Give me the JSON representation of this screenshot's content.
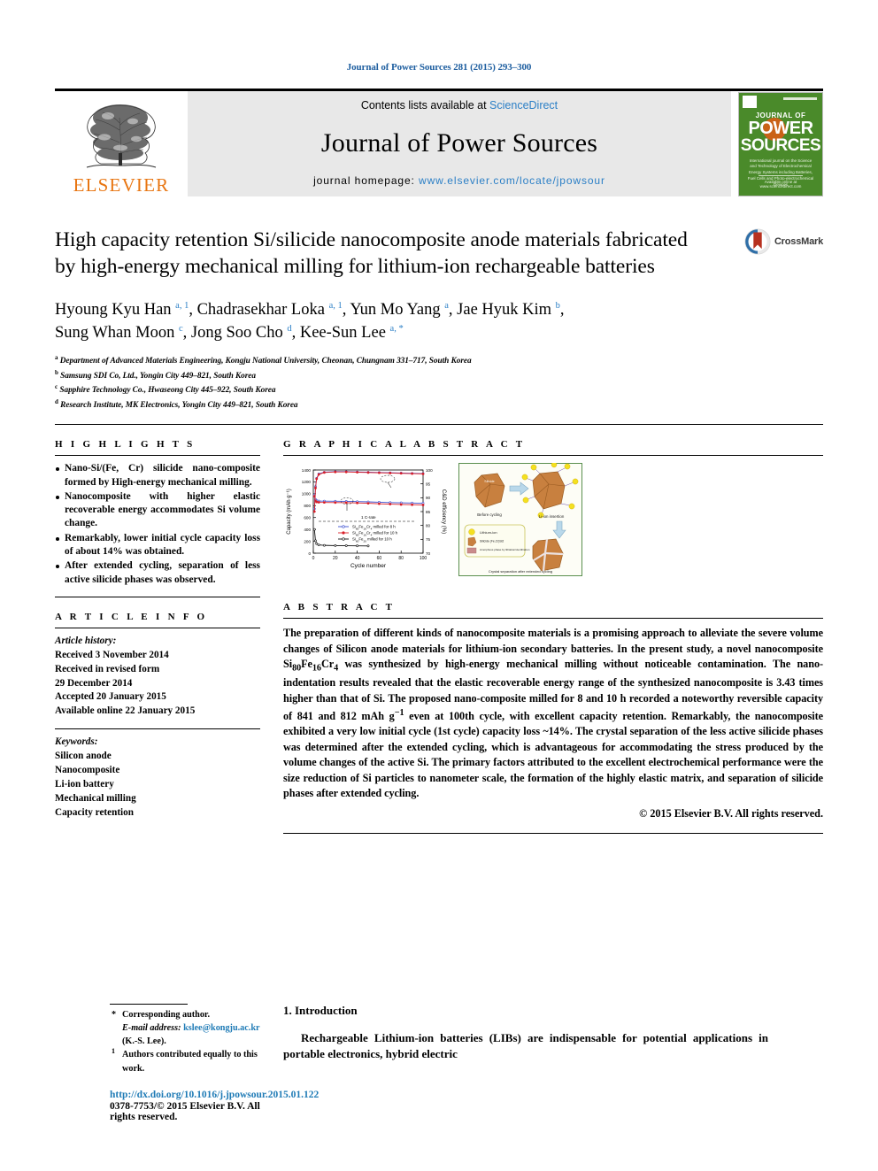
{
  "running_head": "Journal of Power Sources 281 (2015) 293–300",
  "masthead": {
    "publisher": "ELSEVIER",
    "contents_prefix": "Contents lists available at ",
    "contents_link": "ScienceDirect",
    "journal_name": "Journal of Power Sources",
    "homepage_label": "journal homepage:",
    "homepage_url": "www.elsevier.com/locate/jpowsour",
    "cover": {
      "line1": "JOURNAL OF",
      "line2": "POWER",
      "line3": "SOURCES",
      "blurb": "International journal on the Science and Technology of Electrochemical Energy Systems including Batteries, Fuel Cells and Photo-electrochemical Devices",
      "footer": "Available online at www.sciencedirect.com"
    }
  },
  "article": {
    "title": "High capacity retention Si/silicide nanocomposite anode materials fabricated by high-energy mechanical milling for lithium-ion rechargeable batteries",
    "crossmark_label": "CrossMark",
    "authors": [
      {
        "name": "Hyoung Kyu Han",
        "marks": "a, 1"
      },
      {
        "name": "Chadrasekhar Loka",
        "marks": "a, 1"
      },
      {
        "name": "Yun Mo Yang",
        "marks": "a"
      },
      {
        "name": "Jae Hyuk Kim",
        "marks": "b"
      },
      {
        "name": "Sung Whan Moon",
        "marks": "c"
      },
      {
        "name": "Jong Soo Cho",
        "marks": "d"
      },
      {
        "name": "Kee-Sun Lee",
        "marks": "a, *"
      }
    ],
    "affiliations": [
      {
        "mark": "a",
        "text": "Department of Advanced Materials Engineering, Kongju National University, Cheonan, Chungnam 331–717, South Korea"
      },
      {
        "mark": "b",
        "text": "Samsung SDI Co, Ltd., Yongin City 449–821, South Korea"
      },
      {
        "mark": "c",
        "text": "Sapphire Technology Co., Hwaseong City 445–922, South Korea"
      },
      {
        "mark": "d",
        "text": "Research Institute, MK Electronics, Yongin City 449–821, South Korea"
      }
    ]
  },
  "highlights": {
    "heading": "H I G H L I G H T S",
    "items": [
      "Nano-Si/(Fe, Cr) silicide nano-composite formed by High-energy mechanical milling.",
      "Nanocomposite with higher elastic recoverable energy accommodates Si volume change.",
      "Remarkably, lower initial cycle capacity loss of about 14% was obtained.",
      "After extended cycling, separation of less active silicide phases was observed."
    ]
  },
  "article_info": {
    "heading": "A R T I C L E   I N F O",
    "history_label": "Article history:",
    "history": [
      "Received 3 November 2014",
      "Received in revised form",
      "29 December 2014",
      "Accepted 20 January 2015",
      "Available online 22 January 2015"
    ],
    "keywords_label": "Keywords:",
    "keywords": [
      "Silicon anode",
      "Nanocomposite",
      "Li-ion battery",
      "Mechanical milling",
      "Capacity retention"
    ]
  },
  "graphical_abstract": {
    "heading": "G R A P H I C A L   A B S T R A C T",
    "schematic": {
      "stage1_label": "Before cycling",
      "stage2_label": "Li-ion insertion",
      "stage3_label": "Crystal separation after extended cycling",
      "particle_label": "Silicide",
      "legend": [
        "Lithium-ion",
        "Silicide (Fe,Cr)Si2",
        "Amorphous phase by lithiation/de-lithiation"
      ]
    }
  },
  "chart_data": {
    "type": "line",
    "title": "",
    "xlabel": "Cycle number",
    "ylabel": "Capacity (mAh g⁻¹)",
    "y2label": "C&D efficiency (%)",
    "xlim": [
      0,
      100
    ],
    "ylim": [
      0,
      1400
    ],
    "y2lim": [
      70,
      100
    ],
    "xticks": [
      0,
      20,
      40,
      60,
      80,
      100
    ],
    "yticks": [
      0,
      200,
      400,
      600,
      800,
      1000,
      1200,
      1400
    ],
    "y2ticks": [
      70,
      75,
      80,
      85,
      90,
      95,
      100
    ],
    "grid": false,
    "annotation_rate": "1 C-rate",
    "annotation_capacity": "Capacity",
    "annotation_efficiency": "C&D efficiency",
    "legend_position": "center",
    "series": [
      {
        "name": "Si80Fe16Cr4 milled for 8 h",
        "label_html": "Si<sub>80</sub>Fe<sub>16</sub>Cr<sub>4</sub> milled for 8 h",
        "color": "#3b4fd0",
        "axis": "left",
        "x": [
          1,
          2,
          3,
          5,
          10,
          20,
          30,
          40,
          50,
          60,
          70,
          80,
          90,
          100
        ],
        "y": [
          980,
          905,
          885,
          878,
          876,
          874,
          872,
          868,
          864,
          858,
          852,
          848,
          845,
          841
        ]
      },
      {
        "name": "Si80Fe16Cr4 milled for 10 h",
        "label_html": "Si<sub>80</sub>Fe<sub>16</sub>Cr<sub>4</sub> milled for 10 h",
        "color": "#d81e28",
        "axis": "left",
        "x": [
          1,
          2,
          3,
          5,
          10,
          20,
          30,
          40,
          50,
          60,
          70,
          80,
          90,
          100
        ],
        "y": [
          960,
          880,
          862,
          856,
          854,
          852,
          850,
          846,
          840,
          832,
          826,
          820,
          816,
          812
        ]
      },
      {
        "name": "Si80Fe20 milled for 10 h",
        "label_html": "Si<sub>80</sub>Fe<sub>20</sub> milled for 10 h",
        "color": "#111111",
        "axis": "left",
        "x": [
          1,
          2,
          3,
          5,
          10,
          20,
          30,
          40,
          50
        ],
        "y": [
          400,
          210,
          160,
          140,
          132,
          128,
          126,
          124,
          122
        ]
      },
      {
        "name": "C&D efficiency (8 h)",
        "label_html": "C&D efficiency (8 h)",
        "color": "#3b4fd0",
        "axis": "right",
        "x": [
          1,
          2,
          3,
          5,
          10,
          20,
          30,
          40,
          50,
          60,
          70,
          80,
          90,
          100
        ],
        "y": [
          86,
          94,
          97,
          98.6,
          99.2,
          99.4,
          99.4,
          99.3,
          99.2,
          99.1,
          99.0,
          98.9,
          98.8,
          98.7
        ]
      },
      {
        "name": "C&D efficiency (10 h)",
        "label_html": "C&D efficiency (10 h)",
        "color": "#d81e28",
        "axis": "right",
        "x": [
          1,
          2,
          3,
          5,
          10,
          20,
          30,
          40,
          50,
          60,
          70,
          80,
          90,
          100
        ],
        "y": [
          85,
          93.5,
          96.8,
          98.4,
          99.1,
          99.3,
          99.3,
          99.2,
          99.1,
          99.0,
          98.9,
          98.8,
          98.7,
          98.6
        ]
      }
    ]
  },
  "abstract": {
    "heading": "A B S T R A C T",
    "body": "The preparation of different kinds of nanocomposite materials is a promising approach to alleviate the severe volume changes of Silicon anode materials for lithium-ion secondary batteries. In the present study, a novel nanocomposite Si80Fe16Cr4 was synthesized by high-energy mechanical milling without noticeable contamination. The nano-indentation results revealed that the elastic recoverable energy range of the synthesized nanocomposite is 3.43 times higher than that of Si. The proposed nanocomposite milled for 8 and 10 h recorded a noteworthy reversible capacity of 841 and 812 mAh g−1 even at 100th cycle, with excellent capacity retention. Remarkably, the nanocomposite exhibited a very low initial cycle (1st cycle) capacity loss ~14%. The crystal separation of the less active silicide phases was determined after the extended cycling, which is advantageous for accommodating the stress produced by the volume changes of the active Si. The primary factors attributed to the excellent electrochemical performance were the size reduction of Si particles to nanometer scale, the formation of the highly elastic matrix, and separation of silicide phases after extended cycling.",
    "copyright": "© 2015 Elsevier B.V. All rights reserved."
  },
  "footer": {
    "corresponding_mark": "*",
    "corresponding_text": "Corresponding author.",
    "email_label": "E-mail address:",
    "email": "kslee@kongju.ac.kr",
    "email_suffix": "(K.-S. Lee).",
    "equal_mark": "1",
    "equal_text": "Authors contributed equally to this work.",
    "doi": "http://dx.doi.org/10.1016/j.jpowsour.2015.01.122",
    "issn": "0378-7753/© 2015 Elsevier B.V. All rights reserved."
  },
  "introduction": {
    "heading": "1. Introduction",
    "paragraph": "Rechargeable Lithium-ion batteries (LIBs) are indispensable for potential applications in portable electronics, hybrid electric"
  }
}
